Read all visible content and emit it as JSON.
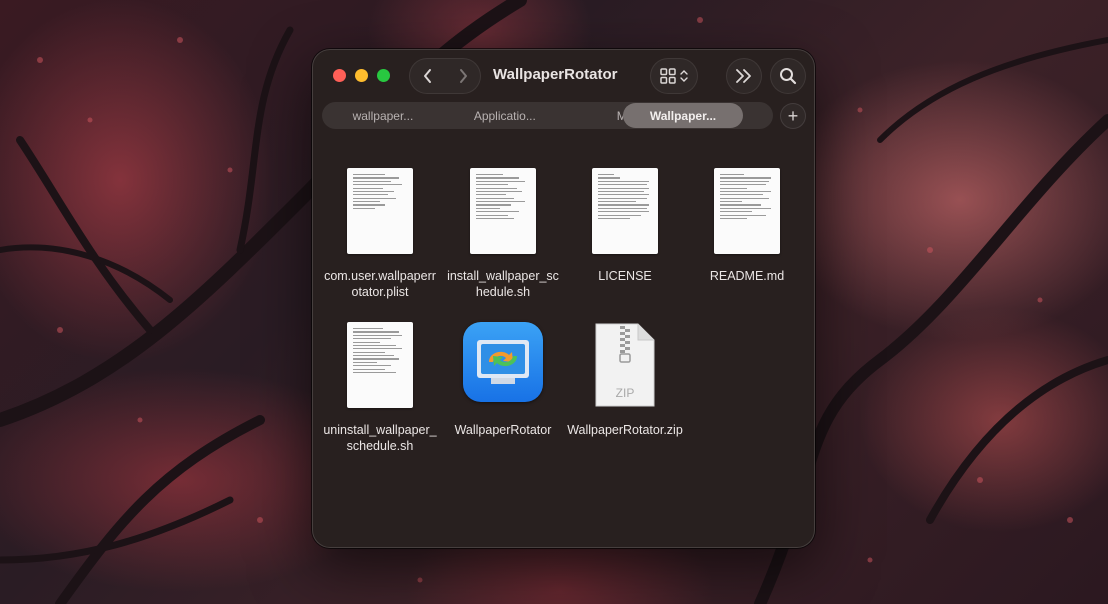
{
  "window": {
    "title": "WallpaperRotator"
  },
  "toolbar": {
    "back_icon": "chevron-left-icon",
    "forward_icon": "chevron-right-icon",
    "view_icon": "grid-view-icon",
    "more_icon": "double-chevron-right-icon",
    "search_icon": "search-icon"
  },
  "tabs": [
    {
      "label": "wallpaper...",
      "active": false
    },
    {
      "label": "Applicatio...",
      "active": false
    },
    {
      "label": "MM",
      "active": false
    },
    {
      "label": "Wallpaper...",
      "active": true
    }
  ],
  "add_tab_label": "+",
  "files": [
    {
      "name": "com.user.wallpaperrotator.plist",
      "kind": "document"
    },
    {
      "name": "install_wallpaper_schedule.sh",
      "kind": "document"
    },
    {
      "name": "LICENSE",
      "kind": "document"
    },
    {
      "name": "README.md",
      "kind": "document"
    },
    {
      "name": "uninstall_wallpaper_schedule.sh",
      "kind": "document"
    },
    {
      "name": "WallpaperRotator",
      "kind": "application"
    },
    {
      "name": "WallpaperRotator.zip",
      "kind": "zip",
      "badge": "ZIP"
    }
  ],
  "colors": {
    "close": "#fe5f57",
    "minimize": "#febc2e",
    "maximize": "#28c840",
    "app_icon_blue": "#1f86ee"
  }
}
